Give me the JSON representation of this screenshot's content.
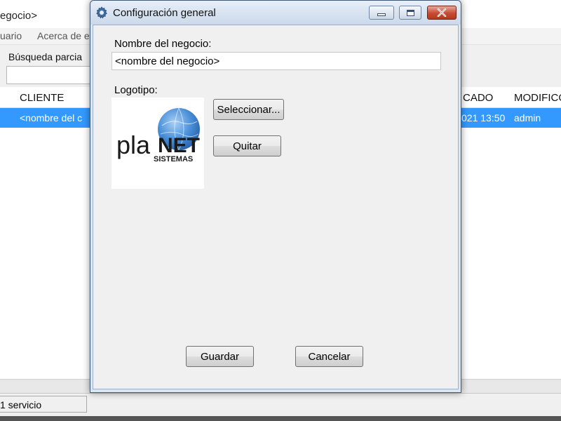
{
  "background_window": {
    "title": "egocio>",
    "menu": [
      "uario",
      "Acerca de e"
    ],
    "search_label": "Búsqueda parcia",
    "table": {
      "columns": [
        "CLIENTE",
        "CADO",
        "MODIFICO"
      ],
      "rows": [
        {
          "cliente": "<nombre del c",
          "fecha": "021 13:50",
          "modifico": "admin"
        }
      ]
    },
    "status": "1 servicio"
  },
  "dialog": {
    "title": "Configuración general",
    "icon": "gear-icon",
    "business_name_label": "Nombre del negocio:",
    "business_name_value": "<nombre del negocio>",
    "logo_label": "Logotipo:",
    "logo": {
      "brand_prefix": "pla",
      "brand_suffix": "NET",
      "tagline": "SISTEMAS"
    },
    "select_button": "Seleccionar...",
    "remove_button": "Quitar",
    "save_button": "Guardar",
    "cancel_button": "Cancelar"
  },
  "colors": {
    "selection": "#3399ff",
    "titlebar": "#dbe6f3",
    "close_button": "#c84a32",
    "logo_globe": "#4a90d9"
  }
}
